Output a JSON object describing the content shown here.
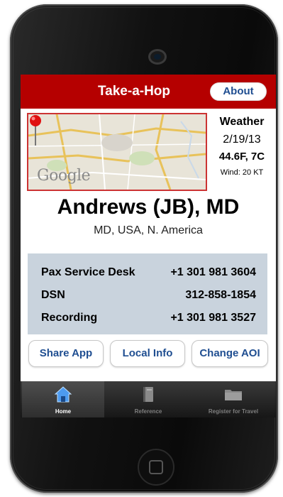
{
  "header": {
    "title": "Take-a-Hop",
    "about_label": "About"
  },
  "map": {
    "brand": "Google"
  },
  "weather": {
    "title": "Weather",
    "date": "2/19/13",
    "temperature": "44.6F, 7C",
    "wind": "Wind: 20 KT"
  },
  "location": {
    "name": "Andrews (JB), MD",
    "region": "MD, USA, N. America"
  },
  "contacts": [
    {
      "label": "Pax Service Desk",
      "number": "+1 301 981 3604"
    },
    {
      "label": "DSN",
      "number": "312-858-1854"
    },
    {
      "label": "Recording",
      "number": "+1 301 981 3527"
    }
  ],
  "actions": {
    "share": "Share App",
    "local": "Local Info",
    "change": "Change AOI"
  },
  "tabs": [
    {
      "label": "Home",
      "icon": "home-icon",
      "active": true
    },
    {
      "label": "Reference",
      "icon": "book-icon",
      "active": false
    },
    {
      "label": "Register for Travel",
      "icon": "folder-icon",
      "active": false
    }
  ],
  "colors": {
    "header": "#b50000",
    "link": "#1f4e91",
    "contact_panel": "#c9d3dd",
    "tab_active": "#ffffff"
  }
}
